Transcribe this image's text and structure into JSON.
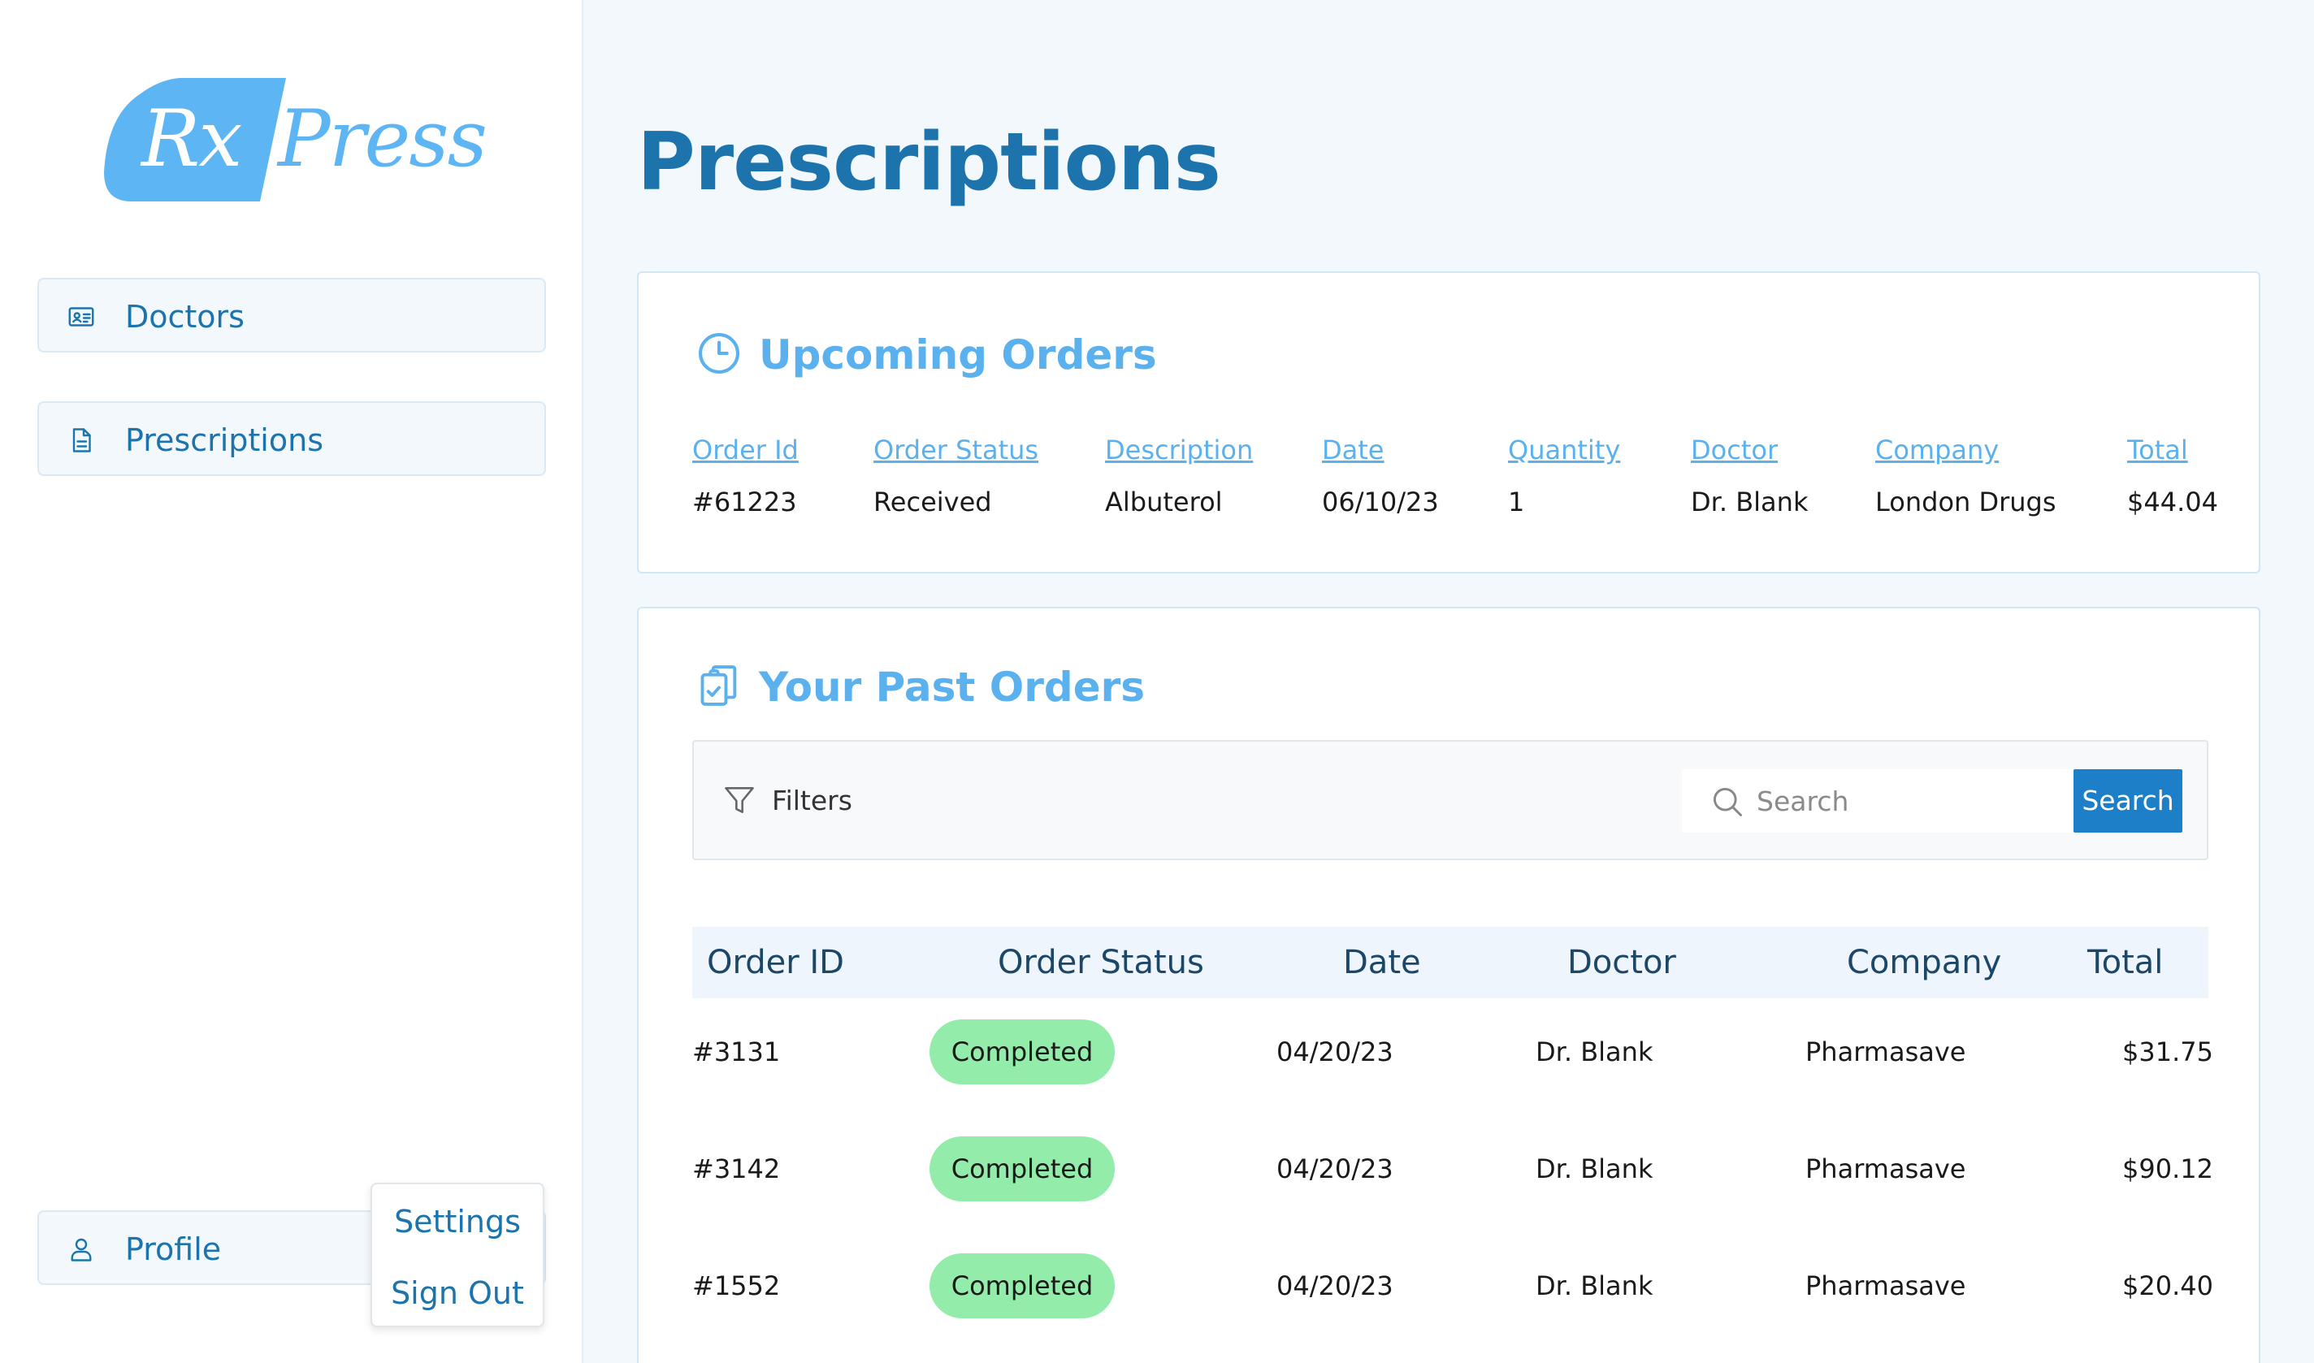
{
  "brand": {
    "logo_rx": "Rx",
    "logo_press": "Press"
  },
  "sidebar": {
    "items": [
      {
        "label": "Doctors",
        "icon": "id-card-icon"
      },
      {
        "label": "Prescriptions",
        "icon": "document-icon"
      }
    ],
    "profile": {
      "label": "Profile",
      "icon": "user-icon"
    },
    "profile_menu": {
      "settings": "Settings",
      "sign_out": "Sign Out"
    }
  },
  "page": {
    "title": "Prescriptions"
  },
  "upcoming": {
    "title": "Upcoming Orders",
    "icon": "clock-icon",
    "headers": [
      "Order Id",
      "Order Status",
      "Description",
      "Date",
      "Quantity",
      "Doctor",
      "Company",
      "Total"
    ],
    "row": [
      "#61223",
      "Received",
      "Albuterol",
      "06/10/23",
      "1",
      "Dr. Blank",
      "London Drugs",
      "$44.04"
    ]
  },
  "past": {
    "title": "Your Past Orders",
    "icon": "clipboard-check-icon",
    "filters_label": "Filters",
    "search_placeholder": "Search",
    "search_button": "Search",
    "headers": [
      "Order ID",
      "Order Status",
      "Date",
      "Doctor",
      "Company",
      "Total"
    ],
    "rows": [
      {
        "id": "#3131",
        "status": "Completed",
        "date": "04/20/23",
        "doctor": "Dr. Blank",
        "company": "Pharmasave",
        "total": "$31.75"
      },
      {
        "id": "#3142",
        "status": "Completed",
        "date": "04/20/23",
        "doctor": "Dr. Blank",
        "company": "Pharmasave",
        "total": "$90.12"
      },
      {
        "id": "#1552",
        "status": "Completed",
        "date": "04/20/23",
        "doctor": "Dr. Blank",
        "company": "Pharmasave",
        "total": "$20.40"
      }
    ]
  },
  "colors": {
    "primary": "#1d74ad",
    "accent_light": "#5ab1ee",
    "logo_blue": "#5db6f3",
    "button_blue": "#1c7fc7",
    "status_completed": "#93eca9",
    "page_bg": "#f3f8fd"
  }
}
